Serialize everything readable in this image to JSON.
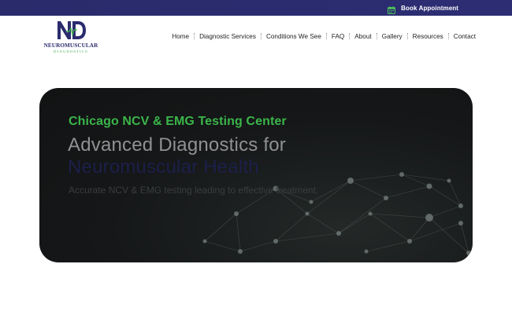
{
  "topbar": {
    "book_label": "Book Appointment",
    "icon": "calendar-icon"
  },
  "logo": {
    "monogram": "ND",
    "name": "NEUROMUSCULAR",
    "subtitle": "DIAGNOSTICS"
  },
  "nav": {
    "items": [
      {
        "label": "Home"
      },
      {
        "label": "Diagnostic Services"
      },
      {
        "label": "Conditions We See"
      },
      {
        "label": "FAQ"
      },
      {
        "label": "About"
      },
      {
        "label": "Gallery"
      },
      {
        "label": "Resources"
      },
      {
        "label": "Contact"
      }
    ]
  },
  "hero": {
    "kicker": "Chicago NCV & EMG Testing Center",
    "title_line1": "Advanced Diagnostics for",
    "title_line2": "Neuromuscular Health",
    "subtitle": "Accurate NCV & EMG testing leading to effective treatment."
  },
  "colors": {
    "brand_navy": "#2b2c6e",
    "brand_green": "#3bb54a",
    "hero_bg": "#151718"
  }
}
